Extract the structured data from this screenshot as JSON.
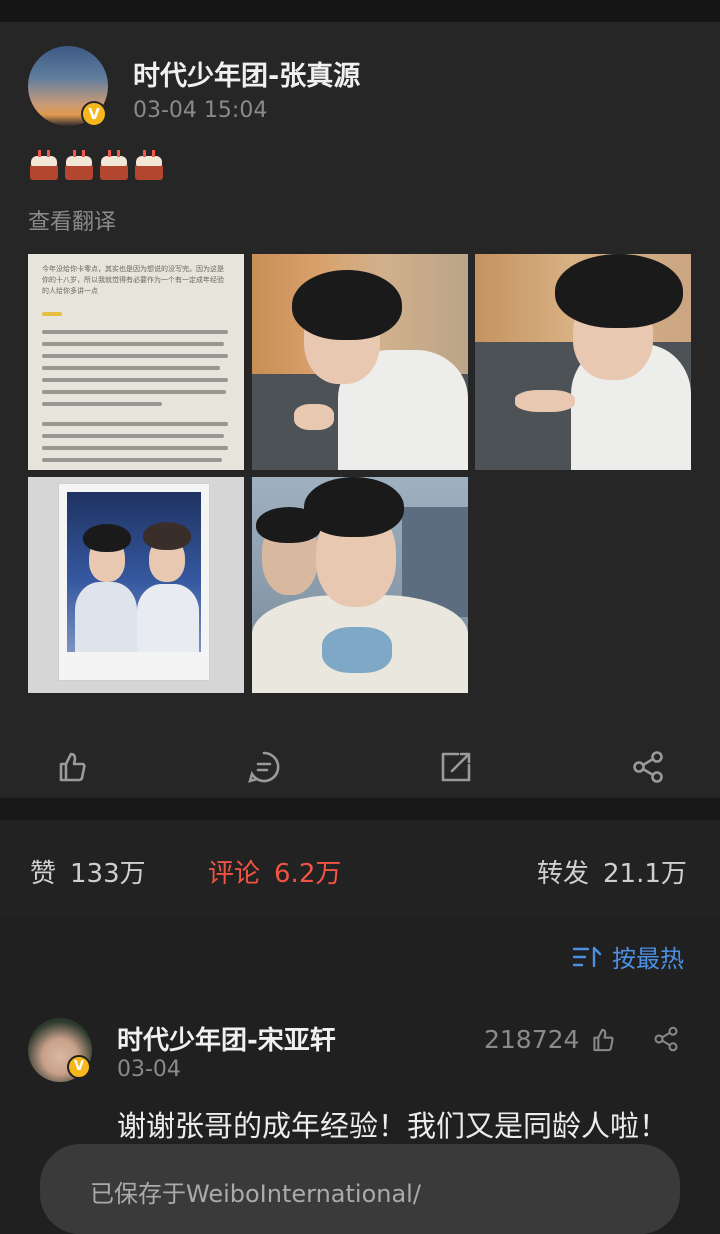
{
  "post": {
    "author": "时代少年团-张真源",
    "time": "03-04 15:04",
    "verified_badge": "V",
    "emoji_text": "🎂🎂🎂🎂",
    "translate_label": "查看翻译",
    "photo_count": 5,
    "letter_photo_text": "今年没给你卡零点，其实也是因为想说的没写完。因为这是你的十八岁，所以我就觉得有必要作为一个有一定成年经验的人给你多讲一点"
  },
  "actions": {
    "like": "like-icon",
    "comment": "comment-icon",
    "repost": "repost-icon",
    "share": "share-icon"
  },
  "stats": {
    "likes_label": "赞",
    "likes_value": "133万",
    "comments_label": "评论",
    "comments_value": "6.2万",
    "reposts_label": "转发",
    "reposts_value": "21.1万"
  },
  "sort": {
    "label": "按最热",
    "icon": "sort-icon"
  },
  "comment": {
    "author": "时代少年团-宋亚轩",
    "date": "03-04",
    "likes": "218724",
    "text": "谢谢张哥的成年经验！我们又是同龄人啦！"
  },
  "toast": {
    "text": "已保存于WeiboInternational/"
  },
  "colors": {
    "accent_blue": "#4d90e0",
    "accent_red": "#f05443",
    "badge_gold": "#f5b71d"
  }
}
